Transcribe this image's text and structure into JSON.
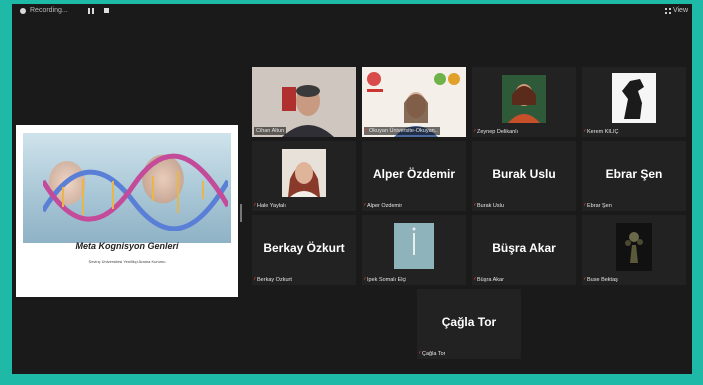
{
  "recording": {
    "label": "Recording...",
    "pause_icon": "pause-icon",
    "stop_icon": "stop-icon"
  },
  "view": {
    "label": "View",
    "icon": "grid-icon"
  },
  "shared_slide": {
    "title": "Meta Kognisyon Genleri",
    "subtitle": "Sevinç Üniversitesi Yenilikçi Arama Kurumu"
  },
  "participants": [
    {
      "name": "Cihan Altun",
      "muted": false,
      "active_speaker": true,
      "has_video": true
    },
    {
      "name": "Okuyan Üniversite-Okuyan..",
      "muted": true,
      "has_video": true
    },
    {
      "name": "Zeynep Delikanlı",
      "muted": true,
      "has_video": true
    },
    {
      "name": "Kerem KILIÇ",
      "muted": true,
      "has_video": true
    },
    {
      "name": "Hale Yaylalı",
      "muted": true,
      "has_video": true
    },
    {
      "name": "Alper Özdemir",
      "display": "Alper Özdemir",
      "muted": true,
      "has_video": false
    },
    {
      "name": "Burak Uslu",
      "display": "Burak Uslu",
      "muted": true,
      "has_video": false
    },
    {
      "name": "Ebrar Şen",
      "display": "Ebrar Şen",
      "muted": true,
      "has_video": false
    },
    {
      "name": "Berkay Özkurt",
      "display": "Berkay Özkurt",
      "muted": true,
      "has_video": false
    },
    {
      "name": "İpek Somalı Elçi",
      "muted": true,
      "has_video": true
    },
    {
      "name": "Büşra Akar",
      "display": "Büşra Akar",
      "muted": true,
      "has_video": false
    },
    {
      "name": "Buse Bektaş",
      "muted": true,
      "has_video": true
    },
    {
      "name": "Çağla Tor",
      "display": "Çağla Tor",
      "muted": true,
      "has_video": false
    }
  ],
  "colors": {
    "frame": "#1fb9a8",
    "background": "#1a1a1a",
    "tile": "#222222",
    "active_border": "#b8e04a",
    "muted_icon": "#e8453c"
  }
}
